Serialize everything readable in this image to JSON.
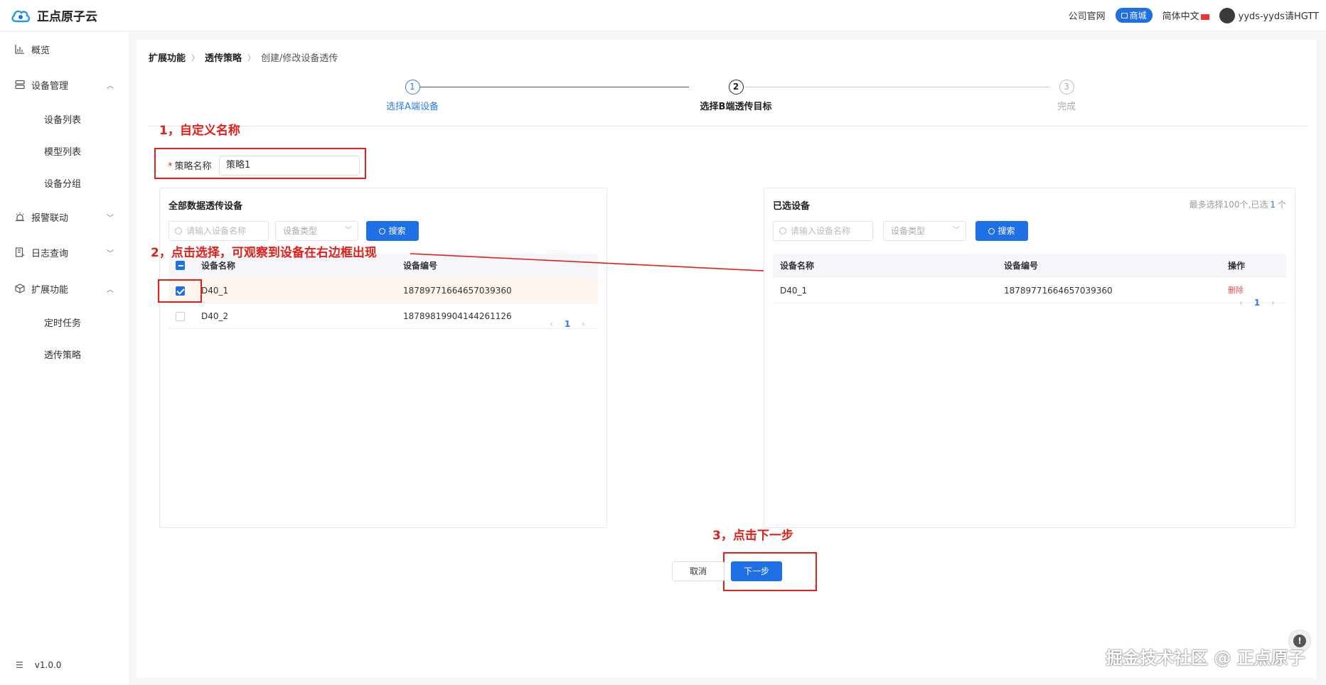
{
  "app": {
    "name": "正点原子云"
  },
  "topbar": {
    "official_site": "公司官网",
    "mall": "商城",
    "language": "简体中文",
    "username": "yyds-yyds请HGTT"
  },
  "sidebar": {
    "items": [
      {
        "label": "概览",
        "icon": "chart-icon"
      },
      {
        "label": "设备管理",
        "icon": "server-icon",
        "expanded": true
      },
      {
        "label": "设备列表",
        "sub": true
      },
      {
        "label": "模型列表",
        "sub": true
      },
      {
        "label": "设备分组",
        "sub": true
      },
      {
        "label": "报警联动",
        "icon": "alarm-icon",
        "expanded": false
      },
      {
        "label": "日志查询",
        "icon": "log-icon",
        "expanded": false
      },
      {
        "label": "扩展功能",
        "icon": "extension-icon",
        "expanded": true
      },
      {
        "label": "定时任务",
        "sub": true
      },
      {
        "label": "透传策略",
        "sub": true
      }
    ],
    "version": "v1.0.0"
  },
  "breadcrumb": [
    "扩展功能",
    "透传策略",
    "创建/修改设备透传"
  ],
  "steps": [
    {
      "num": "1",
      "title": "选择A端设备",
      "state": "done"
    },
    {
      "num": "2",
      "title": "选择B端透传目标",
      "state": "current"
    },
    {
      "num": "3",
      "title": "完成",
      "state": "pending"
    }
  ],
  "annotations": {
    "a1": "1，自定义名称",
    "a2": "2，点击选择，可观察到设备在右边框出现",
    "a3": "3，点击下一步"
  },
  "form": {
    "name_label": "策略名称",
    "name_value": "策略1"
  },
  "left_panel": {
    "title": "全部数据透传设备",
    "search_placeholder": "请输入设备名称",
    "type_placeholder": "设备类型",
    "search_button": "搜索",
    "columns": [
      "设备名称",
      "设备编号"
    ],
    "rows": [
      {
        "name": "D40_1",
        "id": "1878977166465703936​0",
        "checked": true
      },
      {
        "name": "D40_2",
        "id": "1878981990414426112​6",
        "checked": false
      }
    ],
    "page": "1"
  },
  "right_panel": {
    "title": "已选设备",
    "note_prefix": "最多选择100个,已选",
    "note_count": "1",
    "note_suffix": "个",
    "search_placeholder": "请输入设备名称",
    "type_placeholder": "设备类型",
    "search_button": "搜索",
    "columns": [
      "设备名称",
      "设备编号",
      "操作"
    ],
    "rows": [
      {
        "name": "D40_1",
        "id": "1878977166465703936​0",
        "action": "删除"
      }
    ],
    "page": "1"
  },
  "footer": {
    "cancel": "取消",
    "next": "下一步"
  },
  "watermark": "掘金技术社区 @ 正点原子",
  "colors": {
    "primary": "#1f6fe5",
    "annotation": "#e0201a"
  }
}
